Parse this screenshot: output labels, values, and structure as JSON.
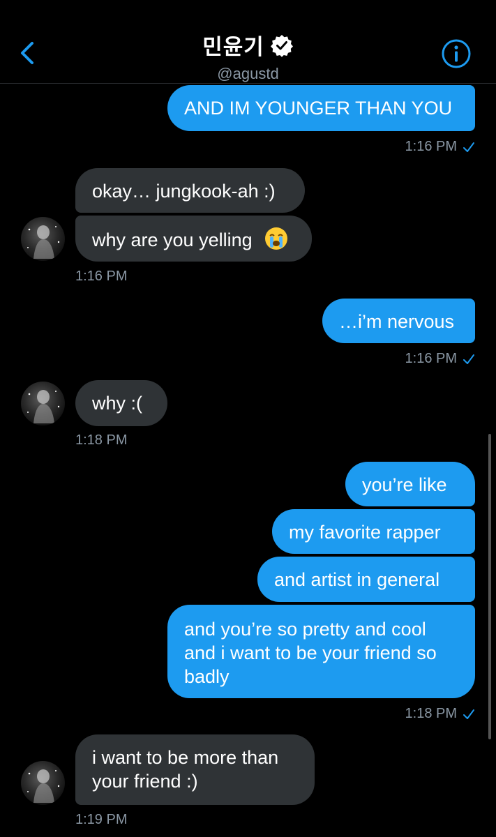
{
  "header": {
    "title": "민윤기",
    "handle": "@agustd",
    "back_icon": "chevron-left-icon",
    "info_icon": "info-icon",
    "verified_icon": "verified-badge-icon"
  },
  "colors": {
    "accent": "#1d9bf0",
    "received_bubble": "#2f3336",
    "timestamp": "#8b98a5",
    "background": "#000000"
  },
  "messages": [
    {
      "direction": "sent",
      "text": "AND IM YOUNGER THAN YOU"
    },
    {
      "direction": "sent",
      "timestamp": "1:16 PM"
    },
    {
      "direction": "received",
      "text": "okay… jungkook-ah :)"
    },
    {
      "direction": "received",
      "text": "why are you yelling",
      "emoji": "loudly-crying-face-emoji"
    },
    {
      "direction": "received",
      "timestamp": "1:16 PM"
    },
    {
      "direction": "sent",
      "text": "…i’m nervous"
    },
    {
      "direction": "sent",
      "timestamp": "1:16 PM"
    },
    {
      "direction": "received",
      "text": "why :("
    },
    {
      "direction": "received",
      "timestamp": "1:18 PM"
    },
    {
      "direction": "sent",
      "text": "you’re like"
    },
    {
      "direction": "sent",
      "text": "my favorite rapper"
    },
    {
      "direction": "sent",
      "text": "and artist in general"
    },
    {
      "direction": "sent",
      "lines": [
        "and you’re so pretty and cool",
        "and i want to be your friend so",
        "badly"
      ]
    },
    {
      "direction": "sent",
      "timestamp": "1:18 PM"
    },
    {
      "direction": "received",
      "lines": [
        "i want to be more than",
        "your friend :)"
      ]
    },
    {
      "direction": "received",
      "timestamp": "1:19 PM"
    }
  ]
}
